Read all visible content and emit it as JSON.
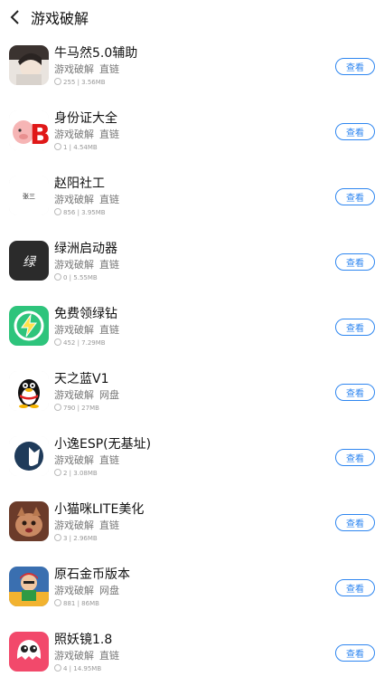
{
  "header": {
    "title": "游戏破解"
  },
  "apps": [
    {
      "name": "牛马然5.0辅助",
      "category": "游戏破解",
      "link_type": "直链",
      "stats": "255 | 3.56MB",
      "button": "查看"
    },
    {
      "name": "身份证大全",
      "category": "游戏破解",
      "link_type": "直链",
      "stats": "1 | 4.54MB",
      "button": "查看"
    },
    {
      "name": "赵阳社工",
      "category": "游戏破解",
      "link_type": "直链",
      "stats": "856 | 3.95MB",
      "button": "查看"
    },
    {
      "name": "绿洲启动器",
      "category": "游戏破解",
      "link_type": "直链",
      "stats": "0 | 5.55MB",
      "button": "查看"
    },
    {
      "name": "免费领绿钻",
      "category": "游戏破解",
      "link_type": "直链",
      "stats": "452 | 7.29MB",
      "button": "查看"
    },
    {
      "name": "天之蓝V1",
      "category": "游戏破解",
      "link_type": "网盘",
      "stats": "790 | 27MB",
      "button": "查看"
    },
    {
      "name": "小逸ESP(无基址)",
      "category": "游戏破解",
      "link_type": "直链",
      "stats": "2 | 3.08MB",
      "button": "查看"
    },
    {
      "name": "小猫咪LITE美化",
      "category": "游戏破解",
      "link_type": "直链",
      "stats": "3 | 2.96MB",
      "button": "查看"
    },
    {
      "name": "原石金币版本",
      "category": "游戏破解",
      "link_type": "网盘",
      "stats": "881 | 86MB",
      "button": "查看"
    },
    {
      "name": "照妖镜1.8",
      "category": "游戏破解",
      "link_type": "直链",
      "stats": "4 | 14.95MB",
      "button": "查看"
    }
  ],
  "icons": [
    {
      "logo_text": ""
    },
    {
      "logo_text": "B"
    },
    {
      "logo_text": "张三"
    },
    {
      "logo_text": "绿"
    },
    {
      "logo_text": ""
    },
    {
      "logo_text": ""
    },
    {
      "logo_text": ""
    },
    {
      "logo_text": ""
    },
    {
      "logo_text": ""
    },
    {
      "logo_text": ""
    }
  ]
}
